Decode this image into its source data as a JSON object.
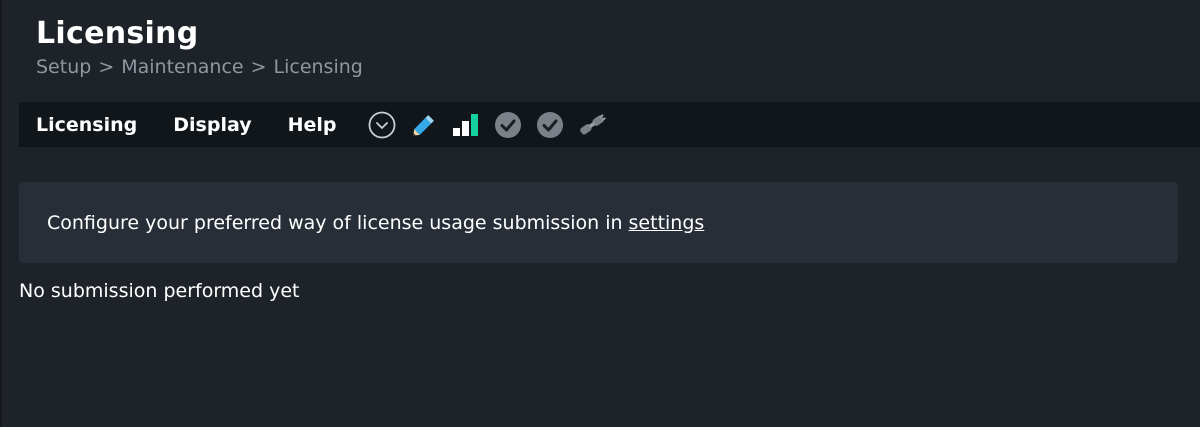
{
  "header": {
    "title": "Licensing",
    "breadcrumb": [
      "Setup",
      "Maintenance",
      "Licensing"
    ],
    "separator": ">"
  },
  "menubar": {
    "items": [
      "Licensing",
      "Display",
      "Help"
    ],
    "icons": [
      "chevron-down-circle-icon",
      "pencil-icon",
      "bar-chart-icon",
      "check-circle-icon",
      "check-circle-icon",
      "plug-icon"
    ]
  },
  "info": {
    "text": "Configure your preferred way of license usage submission in",
    "link_text": "settings"
  },
  "status": {
    "text": "No submission performed yet"
  },
  "colors": {
    "background": "#1e232a",
    "menubar": "#11161b",
    "info_box": "#272e37",
    "accent_green": "#15d1a0",
    "pencil_blue": "#35a8e8"
  }
}
